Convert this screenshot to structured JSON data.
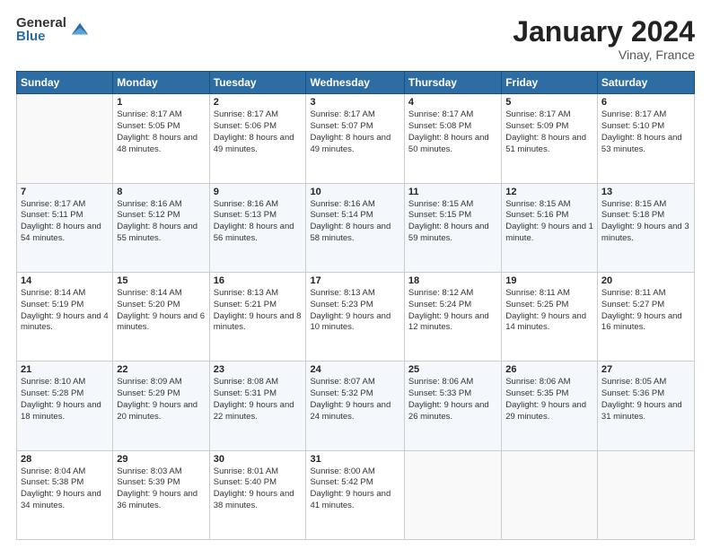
{
  "logo": {
    "general": "General",
    "blue": "Blue"
  },
  "header": {
    "title": "January 2024",
    "location": "Vinay, France"
  },
  "weekdays": [
    "Sunday",
    "Monday",
    "Tuesday",
    "Wednesday",
    "Thursday",
    "Friday",
    "Saturday"
  ],
  "weeks": [
    [
      {
        "day": "",
        "sunrise": "",
        "sunset": "",
        "daylight": ""
      },
      {
        "day": "1",
        "sunrise": "Sunrise: 8:17 AM",
        "sunset": "Sunset: 5:05 PM",
        "daylight": "Daylight: 8 hours and 48 minutes."
      },
      {
        "day": "2",
        "sunrise": "Sunrise: 8:17 AM",
        "sunset": "Sunset: 5:06 PM",
        "daylight": "Daylight: 8 hours and 49 minutes."
      },
      {
        "day": "3",
        "sunrise": "Sunrise: 8:17 AM",
        "sunset": "Sunset: 5:07 PM",
        "daylight": "Daylight: 8 hours and 49 minutes."
      },
      {
        "day": "4",
        "sunrise": "Sunrise: 8:17 AM",
        "sunset": "Sunset: 5:08 PM",
        "daylight": "Daylight: 8 hours and 50 minutes."
      },
      {
        "day": "5",
        "sunrise": "Sunrise: 8:17 AM",
        "sunset": "Sunset: 5:09 PM",
        "daylight": "Daylight: 8 hours and 51 minutes."
      },
      {
        "day": "6",
        "sunrise": "Sunrise: 8:17 AM",
        "sunset": "Sunset: 5:10 PM",
        "daylight": "Daylight: 8 hours and 53 minutes."
      }
    ],
    [
      {
        "day": "7",
        "sunrise": "Sunrise: 8:17 AM",
        "sunset": "Sunset: 5:11 PM",
        "daylight": "Daylight: 8 hours and 54 minutes."
      },
      {
        "day": "8",
        "sunrise": "Sunrise: 8:16 AM",
        "sunset": "Sunset: 5:12 PM",
        "daylight": "Daylight: 8 hours and 55 minutes."
      },
      {
        "day": "9",
        "sunrise": "Sunrise: 8:16 AM",
        "sunset": "Sunset: 5:13 PM",
        "daylight": "Daylight: 8 hours and 56 minutes."
      },
      {
        "day": "10",
        "sunrise": "Sunrise: 8:16 AM",
        "sunset": "Sunset: 5:14 PM",
        "daylight": "Daylight: 8 hours and 58 minutes."
      },
      {
        "day": "11",
        "sunrise": "Sunrise: 8:15 AM",
        "sunset": "Sunset: 5:15 PM",
        "daylight": "Daylight: 8 hours and 59 minutes."
      },
      {
        "day": "12",
        "sunrise": "Sunrise: 8:15 AM",
        "sunset": "Sunset: 5:16 PM",
        "daylight": "Daylight: 9 hours and 1 minute."
      },
      {
        "day": "13",
        "sunrise": "Sunrise: 8:15 AM",
        "sunset": "Sunset: 5:18 PM",
        "daylight": "Daylight: 9 hours and 3 minutes."
      }
    ],
    [
      {
        "day": "14",
        "sunrise": "Sunrise: 8:14 AM",
        "sunset": "Sunset: 5:19 PM",
        "daylight": "Daylight: 9 hours and 4 minutes."
      },
      {
        "day": "15",
        "sunrise": "Sunrise: 8:14 AM",
        "sunset": "Sunset: 5:20 PM",
        "daylight": "Daylight: 9 hours and 6 minutes."
      },
      {
        "day": "16",
        "sunrise": "Sunrise: 8:13 AM",
        "sunset": "Sunset: 5:21 PM",
        "daylight": "Daylight: 9 hours and 8 minutes."
      },
      {
        "day": "17",
        "sunrise": "Sunrise: 8:13 AM",
        "sunset": "Sunset: 5:23 PM",
        "daylight": "Daylight: 9 hours and 10 minutes."
      },
      {
        "day": "18",
        "sunrise": "Sunrise: 8:12 AM",
        "sunset": "Sunset: 5:24 PM",
        "daylight": "Daylight: 9 hours and 12 minutes."
      },
      {
        "day": "19",
        "sunrise": "Sunrise: 8:11 AM",
        "sunset": "Sunset: 5:25 PM",
        "daylight": "Daylight: 9 hours and 14 minutes."
      },
      {
        "day": "20",
        "sunrise": "Sunrise: 8:11 AM",
        "sunset": "Sunset: 5:27 PM",
        "daylight": "Daylight: 9 hours and 16 minutes."
      }
    ],
    [
      {
        "day": "21",
        "sunrise": "Sunrise: 8:10 AM",
        "sunset": "Sunset: 5:28 PM",
        "daylight": "Daylight: 9 hours and 18 minutes."
      },
      {
        "day": "22",
        "sunrise": "Sunrise: 8:09 AM",
        "sunset": "Sunset: 5:29 PM",
        "daylight": "Daylight: 9 hours and 20 minutes."
      },
      {
        "day": "23",
        "sunrise": "Sunrise: 8:08 AM",
        "sunset": "Sunset: 5:31 PM",
        "daylight": "Daylight: 9 hours and 22 minutes."
      },
      {
        "day": "24",
        "sunrise": "Sunrise: 8:07 AM",
        "sunset": "Sunset: 5:32 PM",
        "daylight": "Daylight: 9 hours and 24 minutes."
      },
      {
        "day": "25",
        "sunrise": "Sunrise: 8:06 AM",
        "sunset": "Sunset: 5:33 PM",
        "daylight": "Daylight: 9 hours and 26 minutes."
      },
      {
        "day": "26",
        "sunrise": "Sunrise: 8:06 AM",
        "sunset": "Sunset: 5:35 PM",
        "daylight": "Daylight: 9 hours and 29 minutes."
      },
      {
        "day": "27",
        "sunrise": "Sunrise: 8:05 AM",
        "sunset": "Sunset: 5:36 PM",
        "daylight": "Daylight: 9 hours and 31 minutes."
      }
    ],
    [
      {
        "day": "28",
        "sunrise": "Sunrise: 8:04 AM",
        "sunset": "Sunset: 5:38 PM",
        "daylight": "Daylight: 9 hours and 34 minutes."
      },
      {
        "day": "29",
        "sunrise": "Sunrise: 8:03 AM",
        "sunset": "Sunset: 5:39 PM",
        "daylight": "Daylight: 9 hours and 36 minutes."
      },
      {
        "day": "30",
        "sunrise": "Sunrise: 8:01 AM",
        "sunset": "Sunset: 5:40 PM",
        "daylight": "Daylight: 9 hours and 38 minutes."
      },
      {
        "day": "31",
        "sunrise": "Sunrise: 8:00 AM",
        "sunset": "Sunset: 5:42 PM",
        "daylight": "Daylight: 9 hours and 41 minutes."
      },
      {
        "day": "",
        "sunrise": "",
        "sunset": "",
        "daylight": ""
      },
      {
        "day": "",
        "sunrise": "",
        "sunset": "",
        "daylight": ""
      },
      {
        "day": "",
        "sunrise": "",
        "sunset": "",
        "daylight": ""
      }
    ]
  ]
}
